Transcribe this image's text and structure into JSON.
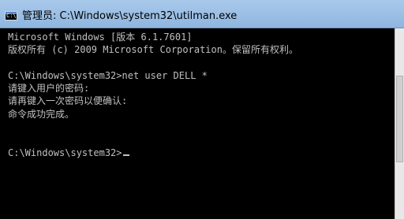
{
  "window": {
    "title": "管理员: C:\\Windows\\system32\\utilman.exe",
    "icon": "cmd-icon"
  },
  "console": {
    "lines": [
      "Microsoft Windows [版本 6.1.7601]",
      "版权所有 (c) 2009 Microsoft Corporation。保留所有权利。",
      "",
      "C:\\Windows\\system32>net user DELL *",
      "请键入用户的密码:",
      "请再键入一次密码以便确认:",
      "命令成功完成。",
      "",
      "",
      "C:\\Windows\\system32>"
    ]
  },
  "colors": {
    "console_bg": "#000000",
    "console_text": "#c0c0c0",
    "titlebar": "#9dc0e6"
  }
}
